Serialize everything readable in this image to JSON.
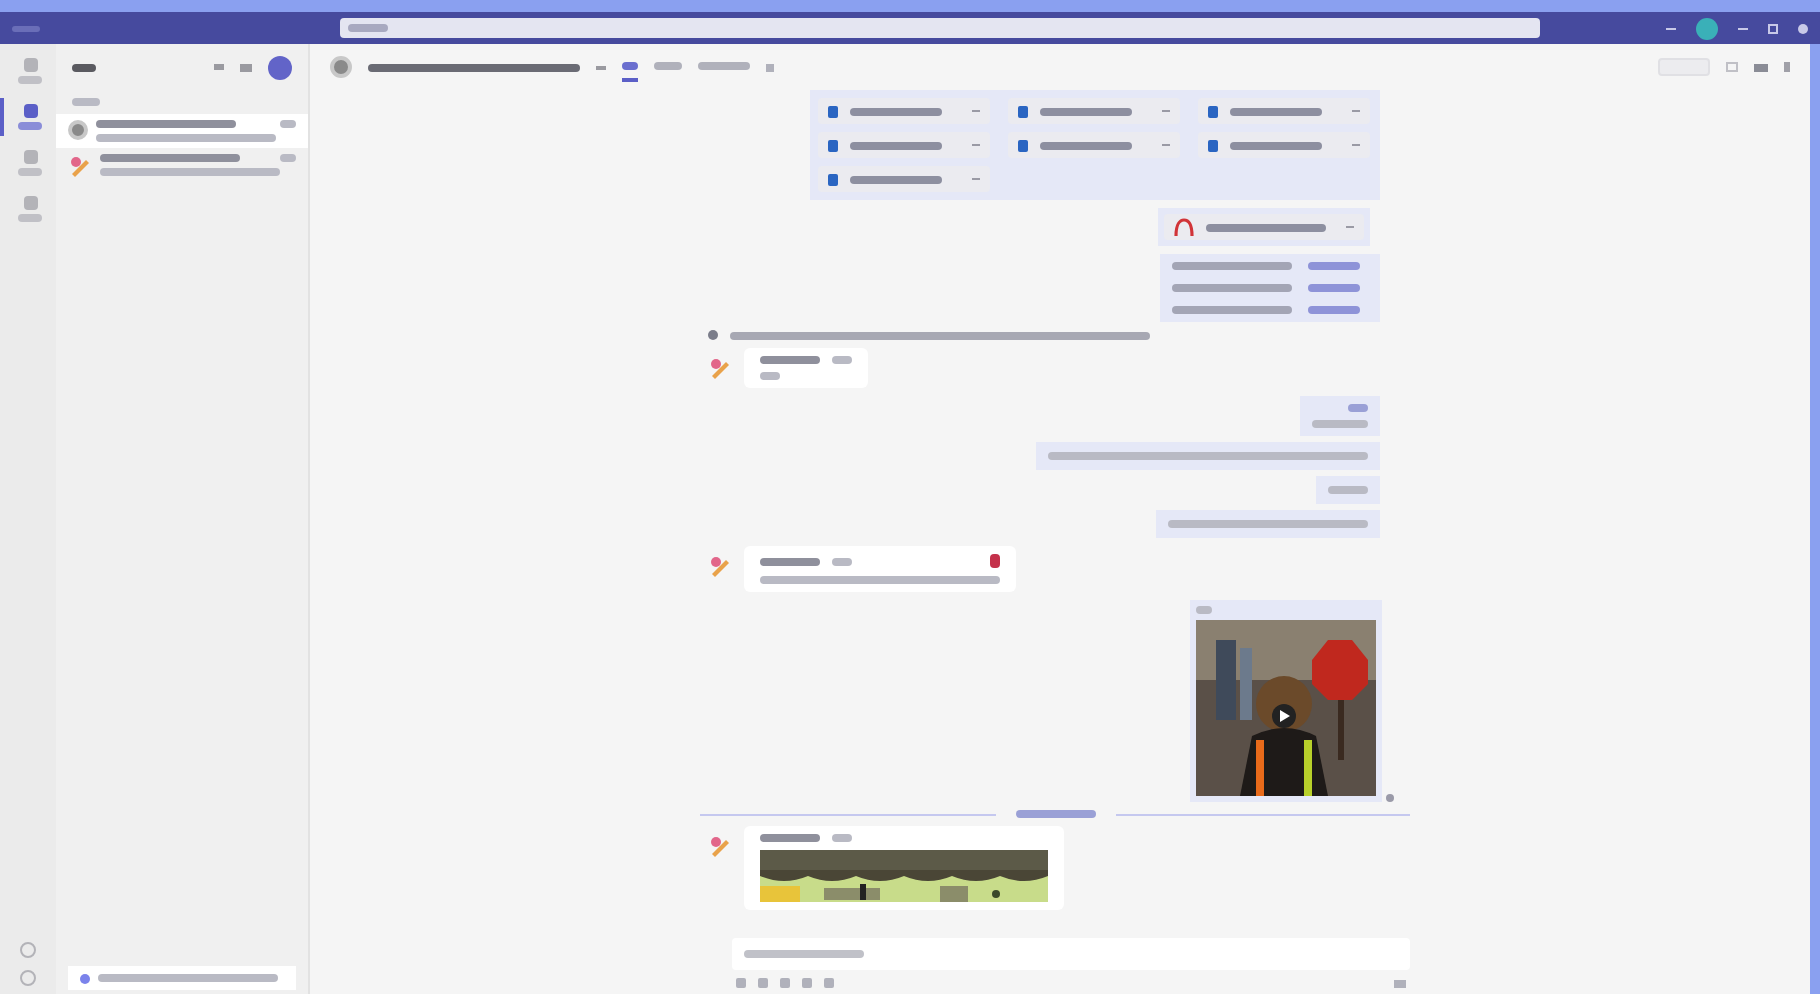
{
  "app_rail": [
    {
      "selected": false
    },
    {
      "selected": true
    },
    {
      "selected": false
    },
    {
      "selected": false
    }
  ],
  "chat_list": [
    {
      "selected": true,
      "kind": "circle"
    },
    {
      "selected": false,
      "kind": "pencil"
    }
  ],
  "header_tabs": [
    {
      "selected": true
    },
    {
      "selected": false
    },
    {
      "selected": false
    }
  ],
  "messages": [
    {
      "kind": "files",
      "files": [
        {
          "kind": "doc"
        },
        {
          "kind": "doc"
        },
        {
          "kind": "doc"
        },
        {
          "kind": "doc"
        },
        {
          "kind": "doc"
        },
        {
          "kind": "doc"
        },
        {
          "kind": "doc"
        }
      ]
    },
    {
      "kind": "files",
      "files": [
        {
          "kind": "pdf"
        }
      ]
    },
    {
      "kind": "links",
      "links": [
        {
          "kind": "link"
        },
        {
          "kind": "link"
        },
        {
          "kind": "link"
        }
      ]
    },
    {
      "kind": "system"
    },
    {
      "kind": "incoming",
      "reaction": false,
      "picture": false
    },
    {
      "kind": "outgoing"
    },
    {
      "kind": "incoming",
      "reaction": true,
      "picture": false
    },
    {
      "kind": "video"
    },
    {
      "kind": "divider"
    },
    {
      "kind": "incoming",
      "reaction": false,
      "picture": true
    }
  ]
}
